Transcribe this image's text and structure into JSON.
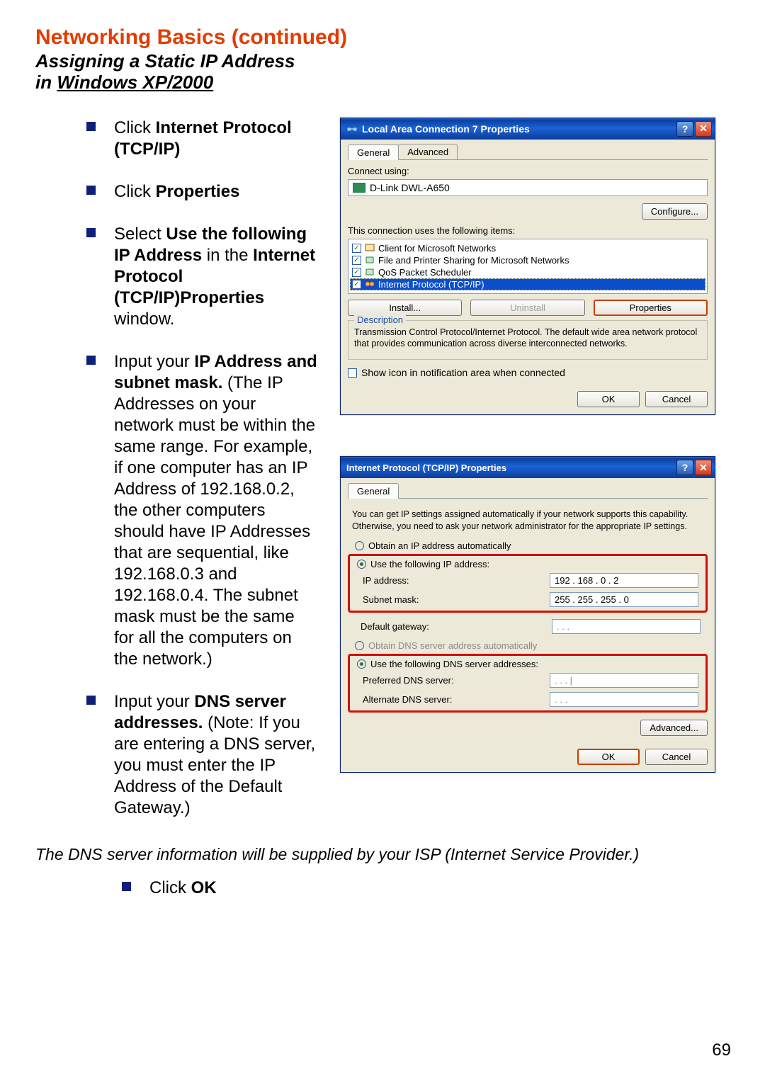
{
  "header": {
    "title": "Networking Basics  (continued)",
    "subtitle_line1": "Assigning a Static IP Address",
    "subtitle_line2_prefix": "in ",
    "subtitle_line2_underlined": "Windows XP/2000"
  },
  "instructions": {
    "items": [
      {
        "prefix": "Click ",
        "bold": "Internet Protocol (TCP/IP)",
        "suffix": ""
      },
      {
        "prefix": "Click ",
        "bold": "Properties",
        "suffix": ""
      },
      {
        "prefix": "Select ",
        "bold": "Use the following IP Address",
        "mid": " in the ",
        "bold2": "Internet Protocol (TCP/IP)Properties",
        "suffix": " window."
      },
      {
        "prefix": "Input your ",
        "bold": "IP Address and subnet mask.",
        "suffix": " (The IP Addresses on your network must be within the same range. For example, if one computer has an IP Address of 192.168.0.2, the other computers should have IP Addresses that are sequential, like 192.168.0.3 and 192.168.0.4. The subnet mask must be the same for all the computers on the network.)"
      },
      {
        "prefix": "Input your ",
        "bold": "DNS server addresses.",
        "suffix": " (Note: If you are entering a DNS server, you must enter the IP Address of the Default Gateway.)"
      },
      {
        "prefix": "Click ",
        "bold": "OK",
        "suffix": ""
      }
    ],
    "note": "The DNS server information will be supplied by your ISP (Internet Service Provider.)"
  },
  "page_number": "69",
  "dialog1": {
    "title": "Local Area Connection 7 Properties",
    "tabs": {
      "general": "General",
      "advanced": "Advanced"
    },
    "connect_using_label": "Connect using:",
    "adapter": "D-Link DWL-A650",
    "configure_btn": "Configure...",
    "items_label": "This connection uses the following items:",
    "list": {
      "item1": "Client for Microsoft Networks",
      "item2": "File and Printer Sharing for Microsoft Networks",
      "item3": "QoS Packet Scheduler",
      "item4": "Internet Protocol (TCP/IP)"
    },
    "install_btn": "Install...",
    "uninstall_btn": "Uninstall",
    "properties_btn": "Properties",
    "description_label": "Description",
    "description_text": "Transmission Control Protocol/Internet Protocol. The default wide area network protocol that provides communication across diverse interconnected networks.",
    "show_icon_label": "Show icon in notification area when connected",
    "ok_btn": "OK",
    "cancel_btn": "Cancel"
  },
  "dialog2": {
    "title": "Internet Protocol (TCP/IP) Properties",
    "tab_general": "General",
    "info_text": "You can get IP settings assigned automatically if your network supports this capability. Otherwise, you need to ask your network administrator for the appropriate IP settings.",
    "radio_auto_ip": "Obtain an IP address automatically",
    "radio_static_ip": "Use the following IP address:",
    "ip_label": "IP address:",
    "ip_value": "192 . 168 .   0   .   2",
    "subnet_label": "Subnet mask:",
    "subnet_value": "255 . 255 . 255 .   0",
    "gateway_label": "Default gateway:",
    "gateway_value": ".        .        .",
    "radio_auto_dns": "Obtain DNS server address automatically",
    "radio_static_dns": "Use the following DNS server addresses:",
    "pref_dns_label": "Preferred DNS server:",
    "pref_dns_value": ".        .        .   |",
    "alt_dns_label": "Alternate DNS server:",
    "alt_dns_value": ".        .        .",
    "advanced_btn": "Advanced...",
    "ok_btn": "OK",
    "cancel_btn": "Cancel"
  }
}
